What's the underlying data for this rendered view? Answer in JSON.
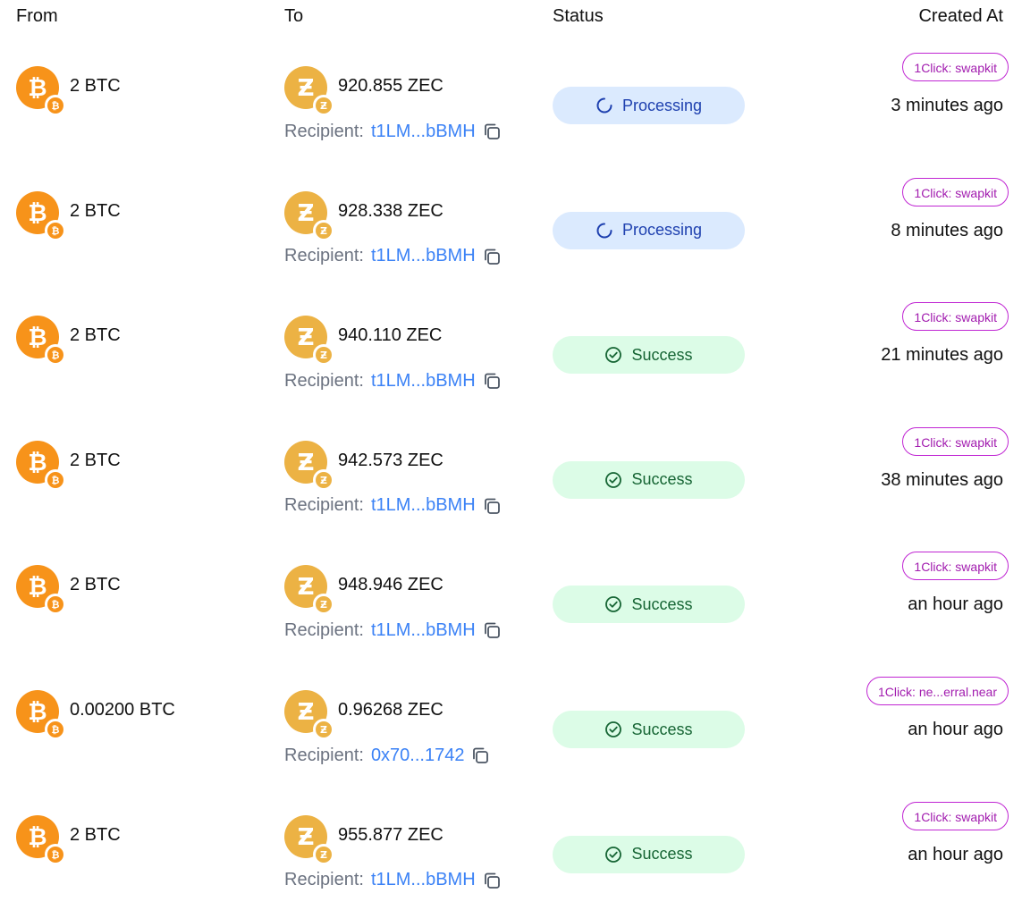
{
  "header": {
    "from": "From",
    "to": "To",
    "status": "Status",
    "created_at": "Created At"
  },
  "colors": {
    "btc": "#f7931a",
    "zec": "#ecb244",
    "link": "#3b82f6",
    "processing_bg": "#dbeafe",
    "processing_fg": "#1e40af",
    "success_bg": "#dcfce7",
    "success_fg": "#166534",
    "tag_border": "#c026d3"
  },
  "icons": {
    "from": "bitcoin-icon",
    "to": "zcash-icon",
    "copy": "copy-icon",
    "processing": "spinner-icon",
    "success": "check-circle-icon"
  },
  "rows": [
    {
      "from_amount": "2 BTC",
      "to_amount": "920.855 ZEC",
      "recipient_label": "Recipient:",
      "recipient_addr": "t1LM...bBMH",
      "status": "Processing",
      "status_type": "processing",
      "tag": "1Click: swapkit",
      "time": "3 minutes ago"
    },
    {
      "from_amount": "2 BTC",
      "to_amount": "928.338 ZEC",
      "recipient_label": "Recipient:",
      "recipient_addr": "t1LM...bBMH",
      "status": "Processing",
      "status_type": "processing",
      "tag": "1Click: swapkit",
      "time": "8 minutes ago"
    },
    {
      "from_amount": "2 BTC",
      "to_amount": "940.110 ZEC",
      "recipient_label": "Recipient:",
      "recipient_addr": "t1LM...bBMH",
      "status": "Success",
      "status_type": "success",
      "tag": "1Click: swapkit",
      "time": "21 minutes ago"
    },
    {
      "from_amount": "2 BTC",
      "to_amount": "942.573 ZEC",
      "recipient_label": "Recipient:",
      "recipient_addr": "t1LM...bBMH",
      "status": "Success",
      "status_type": "success",
      "tag": "1Click: swapkit",
      "time": "38 minutes ago"
    },
    {
      "from_amount": "2 BTC",
      "to_amount": "948.946 ZEC",
      "recipient_label": "Recipient:",
      "recipient_addr": "t1LM...bBMH",
      "status": "Success",
      "status_type": "success",
      "tag": "1Click: swapkit",
      "time": "an hour ago"
    },
    {
      "from_amount": "0.00200 BTC",
      "to_amount": "0.96268 ZEC",
      "recipient_label": "Recipient:",
      "recipient_addr": "0x70...1742",
      "status": "Success",
      "status_type": "success",
      "tag": "1Click: ne...erral.near",
      "time": "an hour ago"
    },
    {
      "from_amount": "2 BTC",
      "to_amount": "955.877 ZEC",
      "recipient_label": "Recipient:",
      "recipient_addr": "t1LM...bBMH",
      "status": "Success",
      "status_type": "success",
      "tag": "1Click: swapkit",
      "time": "an hour ago"
    }
  ]
}
